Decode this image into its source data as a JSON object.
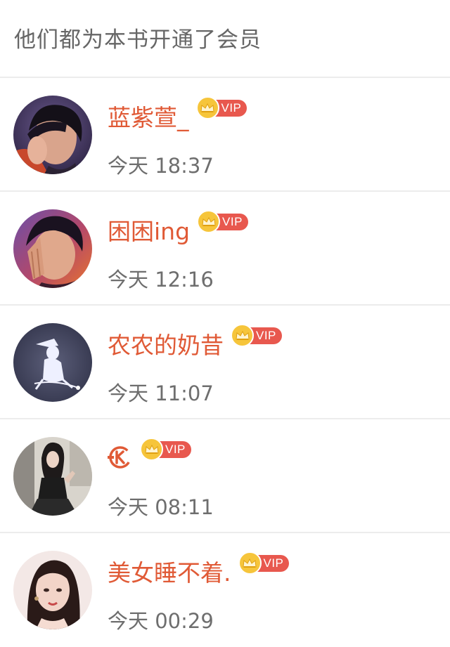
{
  "header": {
    "title": "他们都为本书开通了会员"
  },
  "badge": {
    "label": "VIP"
  },
  "members": [
    {
      "name": "蓝紫萱_",
      "time": "今天 18:37",
      "avatar": "dark-hair-portrait"
    },
    {
      "name": "困困ing",
      "time": "今天 12:16",
      "avatar": "hand-on-face-portrait"
    },
    {
      "name": "农农的奶昔",
      "time": "今天 11:07",
      "avatar": "witch-silhouette"
    },
    {
      "name": "",
      "time": "今天 08:11",
      "avatar": "mirror-selfie",
      "name_icon": "k-logo-icon"
    },
    {
      "name": "美女睡不着.",
      "time": "今天 00:29",
      "avatar": "girl-portrait"
    }
  ],
  "colors": {
    "name": "#e05a36",
    "time": "#6e6e6e",
    "vip_pill": "#e8584e",
    "crown": "#f6c53b",
    "divider": "#ececec"
  }
}
